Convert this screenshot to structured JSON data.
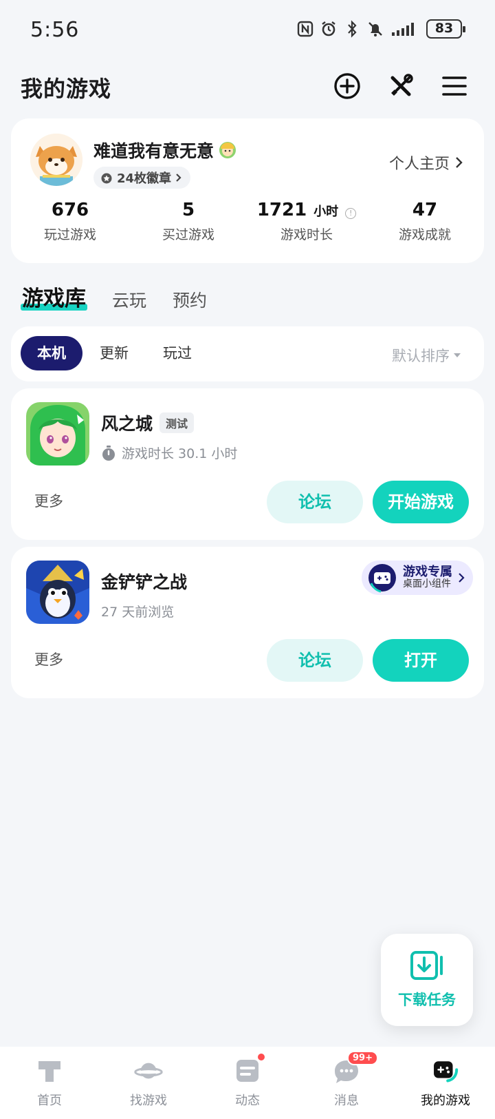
{
  "status_bar": {
    "time": "5:56",
    "battery": "83",
    "icons": [
      "nfc-icon",
      "alarm-icon",
      "bluetooth-icon",
      "mute-icon",
      "signal-icon"
    ]
  },
  "header": {
    "title": "我的游戏",
    "actions": [
      "add-icon",
      "tools-icon",
      "menu-icon"
    ]
  },
  "profile": {
    "username": "难道我有意无意",
    "badges": "24枚徽章",
    "profile_link": "个人主页",
    "stats": [
      {
        "value": "676",
        "unit": "",
        "label": "玩过游戏"
      },
      {
        "value": "5",
        "unit": "",
        "label": "买过游戏"
      },
      {
        "value": "1721",
        "unit": "小时",
        "label": "游戏时长"
      },
      {
        "value": "47",
        "unit": "",
        "label": "游戏成就"
      }
    ]
  },
  "main_tabs": [
    "游戏库",
    "云玩",
    "预约"
  ],
  "active_main_tab": "游戏库",
  "filters": {
    "chips": [
      "本机",
      "更新",
      "玩过"
    ],
    "active": "本机",
    "sort": "默认排序"
  },
  "games": [
    {
      "name": "风之城",
      "tag": "测试",
      "subtitle": "游戏时长 30.1 小时",
      "more": "更多",
      "forum": "论坛",
      "primary": "开始游戏"
    },
    {
      "name": "金铲铲之战",
      "subtitle": "27 天前浏览",
      "more": "更多",
      "forum": "论坛",
      "primary": "打开",
      "promo": {
        "title": "游戏专属",
        "subtitle": "桌面小组件"
      }
    }
  ],
  "fab": {
    "label": "下载任务"
  },
  "bottom_nav": [
    {
      "label": "首页",
      "icon": "home-icon"
    },
    {
      "label": "找游戏",
      "icon": "planet-icon"
    },
    {
      "label": "动态",
      "icon": "feed-icon"
    },
    {
      "label": "消息",
      "icon": "message-icon",
      "badge": "99+"
    },
    {
      "label": "我的游戏",
      "icon": "gamepad-icon"
    }
  ],
  "colors": {
    "accent": "#13d3bd",
    "navy": "#1c1c6e",
    "badge_red": "#ff4d4f"
  }
}
